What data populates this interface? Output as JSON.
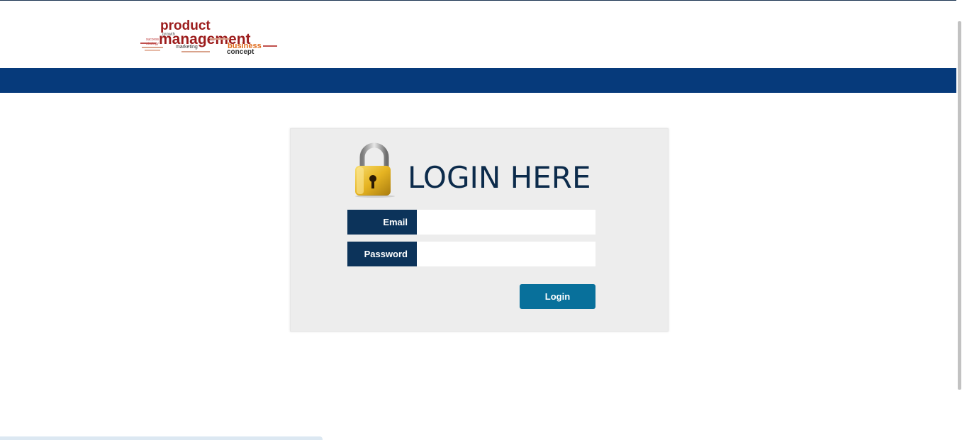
{
  "header": {
    "logo": {
      "lines": [
        "product",
        "management",
        "business",
        "concept",
        "growth",
        "marketing",
        "strategy",
        "success"
      ],
      "colors": {
        "primary": "#9c1c1c",
        "secondary": "#e06a1a",
        "dark": "#333333"
      }
    },
    "band_color": "#063a7b"
  },
  "login": {
    "title": "LOGIN HERE",
    "icon": "padlock-icon",
    "email_label": "Email",
    "email_value": "",
    "password_label": "Password",
    "password_value": "",
    "button_label": "Login"
  },
  "colors": {
    "label_bg": "#0c335a",
    "button_bg": "#08709b",
    "panel_bg": "#ededed",
    "title_color": "#0c2b4b"
  }
}
